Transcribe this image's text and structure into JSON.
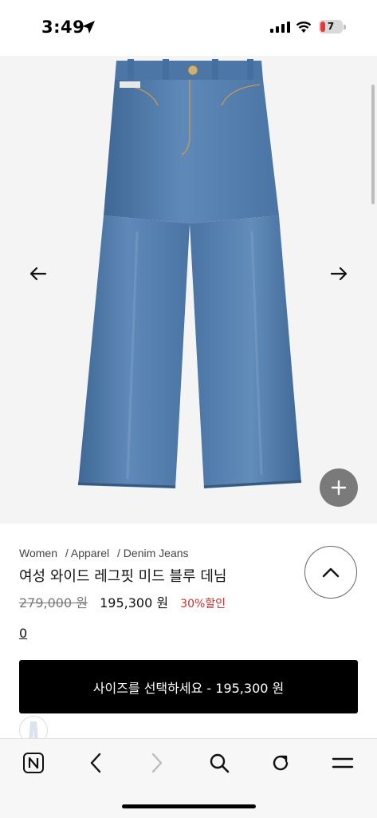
{
  "status_bar": {
    "time": "3:49",
    "battery_level": "7"
  },
  "breadcrumb": [
    "Women",
    "/ Apparel",
    "/ Denim Jeans"
  ],
  "product": {
    "title": "여성 와이드 레그핏 미드 블루 데님",
    "original_price": "279,000 원",
    "sale_price": "195,300 원",
    "discount": "30%할인",
    "review_count": "0"
  },
  "cta": {
    "label": "사이즈를 선택하세요 - 195,300 원"
  },
  "icons": {
    "gallery_prev": "arrow-left-icon",
    "gallery_next": "arrow-right-icon",
    "zoom": "plus-icon",
    "scroll_top": "chevron-up-icon"
  },
  "toolbar": [
    "naver-home-icon",
    "back-icon",
    "forward-icon",
    "search-icon",
    "refresh-icon",
    "menu-icon"
  ],
  "colors": {
    "cta_background": "#000000",
    "discount": "#d32f2f",
    "denim": "#4f79a8",
    "battery_low": "#e53935"
  }
}
